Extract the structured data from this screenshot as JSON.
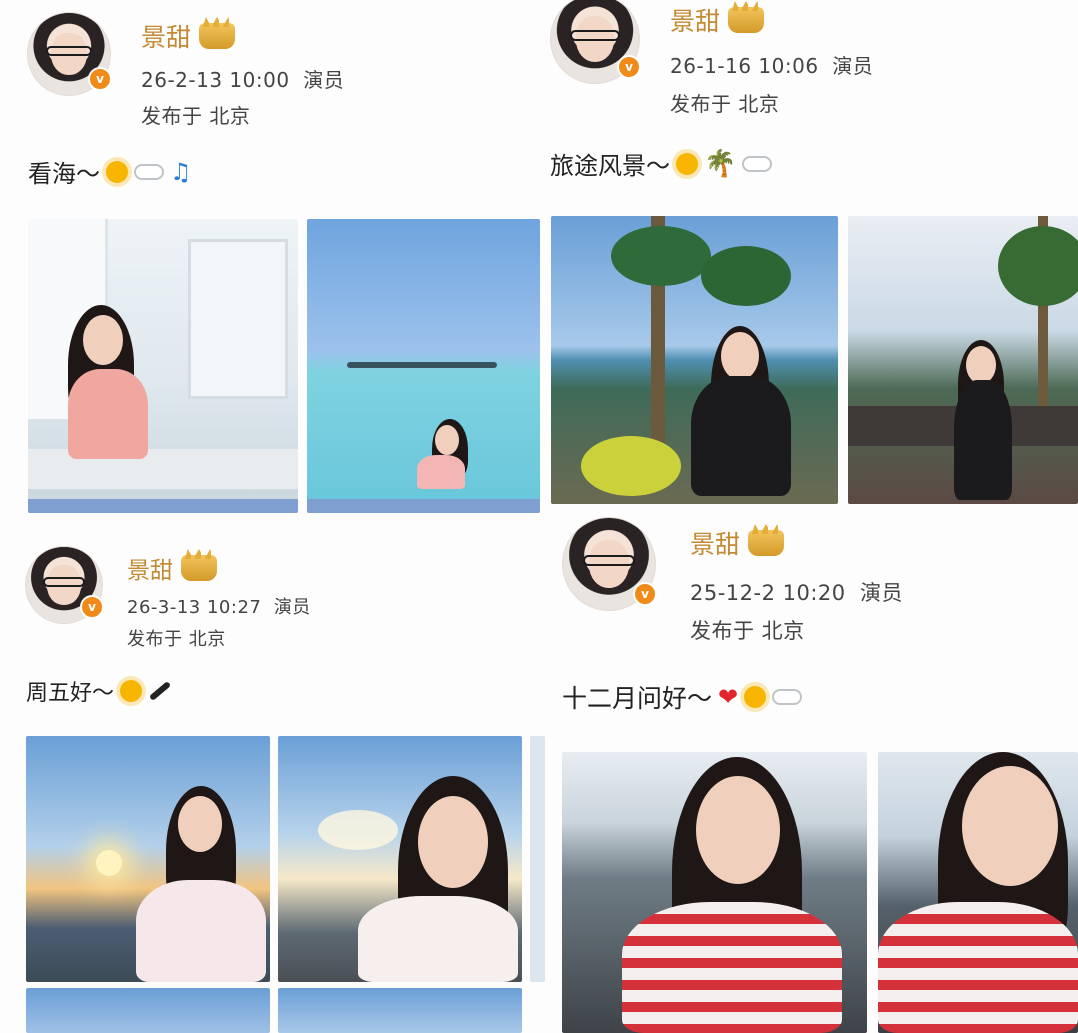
{
  "posts": [
    {
      "name": "景甜",
      "time": "26-2-13 10:00",
      "role": "演员",
      "location": "发布于 北京",
      "text": "看海～",
      "emojis": [
        "sun",
        "cloud",
        "music-note"
      ]
    },
    {
      "name": "景甜",
      "time": "26-1-16 10:06",
      "role": "演员",
      "location": "发布于 北京",
      "text": "旅途风景～",
      "emojis": [
        "sun",
        "palm-tree",
        "cloud"
      ]
    },
    {
      "name": "景甜",
      "time": "26-3-13 10:27",
      "role": "演员",
      "location": "发布于 北京",
      "text": "周五好～",
      "emojis": [
        "sun",
        "phone-stick"
      ]
    },
    {
      "name": "景甜",
      "time": "25-12-2 10:20",
      "role": "演员",
      "location": "发布于 北京",
      "text": "十二月问好～",
      "emojis": [
        "heart",
        "sun",
        "cloud"
      ]
    }
  ],
  "verified_badge": "v",
  "colors": {
    "username": "#c28a32",
    "badge": "#f08a19",
    "meta": "#444444",
    "content": "#222222"
  }
}
